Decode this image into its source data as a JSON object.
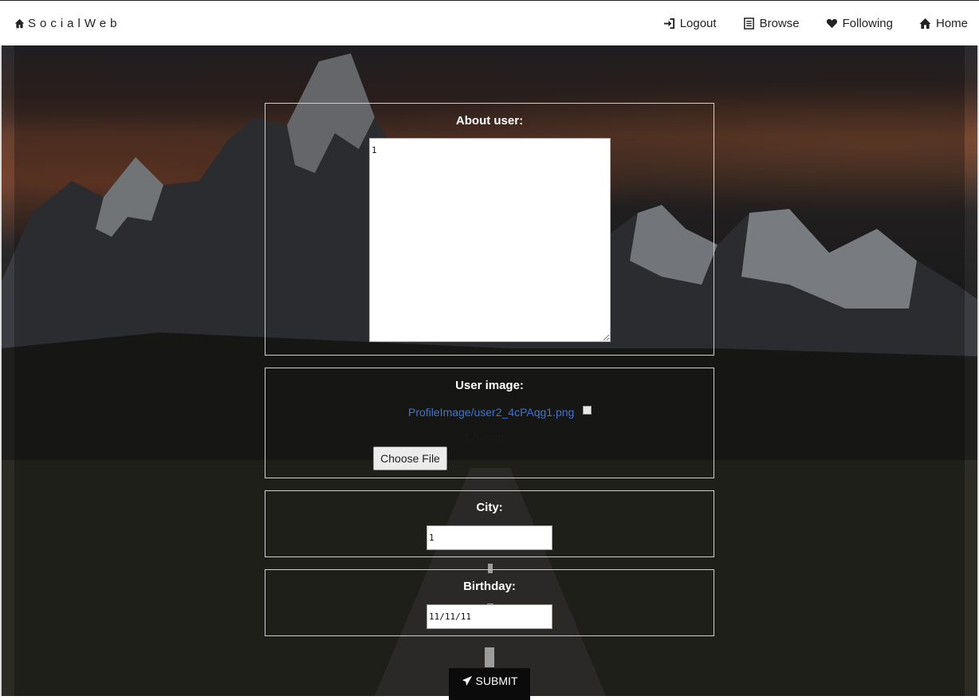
{
  "navbar": {
    "brand": "SocialWeb",
    "items": [
      {
        "label": "Logout",
        "icon": "logout-icon"
      },
      {
        "label": "Browse",
        "icon": "list-icon"
      },
      {
        "label": "Following",
        "icon": "heart-icon"
      },
      {
        "label": "Home",
        "icon": "home-icon"
      }
    ]
  },
  "form": {
    "about": {
      "label": "About user:",
      "value": "1"
    },
    "image": {
      "label": "User image:",
      "current_file": "ProfileImage/user2_4cPAqg1.png",
      "change_text": "Change:",
      "choose_button": "Choose File"
    },
    "city": {
      "label": "City:",
      "value": "1"
    },
    "birthday": {
      "label": "Birthday:",
      "value": "11/11/11"
    },
    "submit": "SUBMIT"
  },
  "colors": {
    "link": "#3b74d4",
    "submit_bg": "#0b0b0b"
  }
}
